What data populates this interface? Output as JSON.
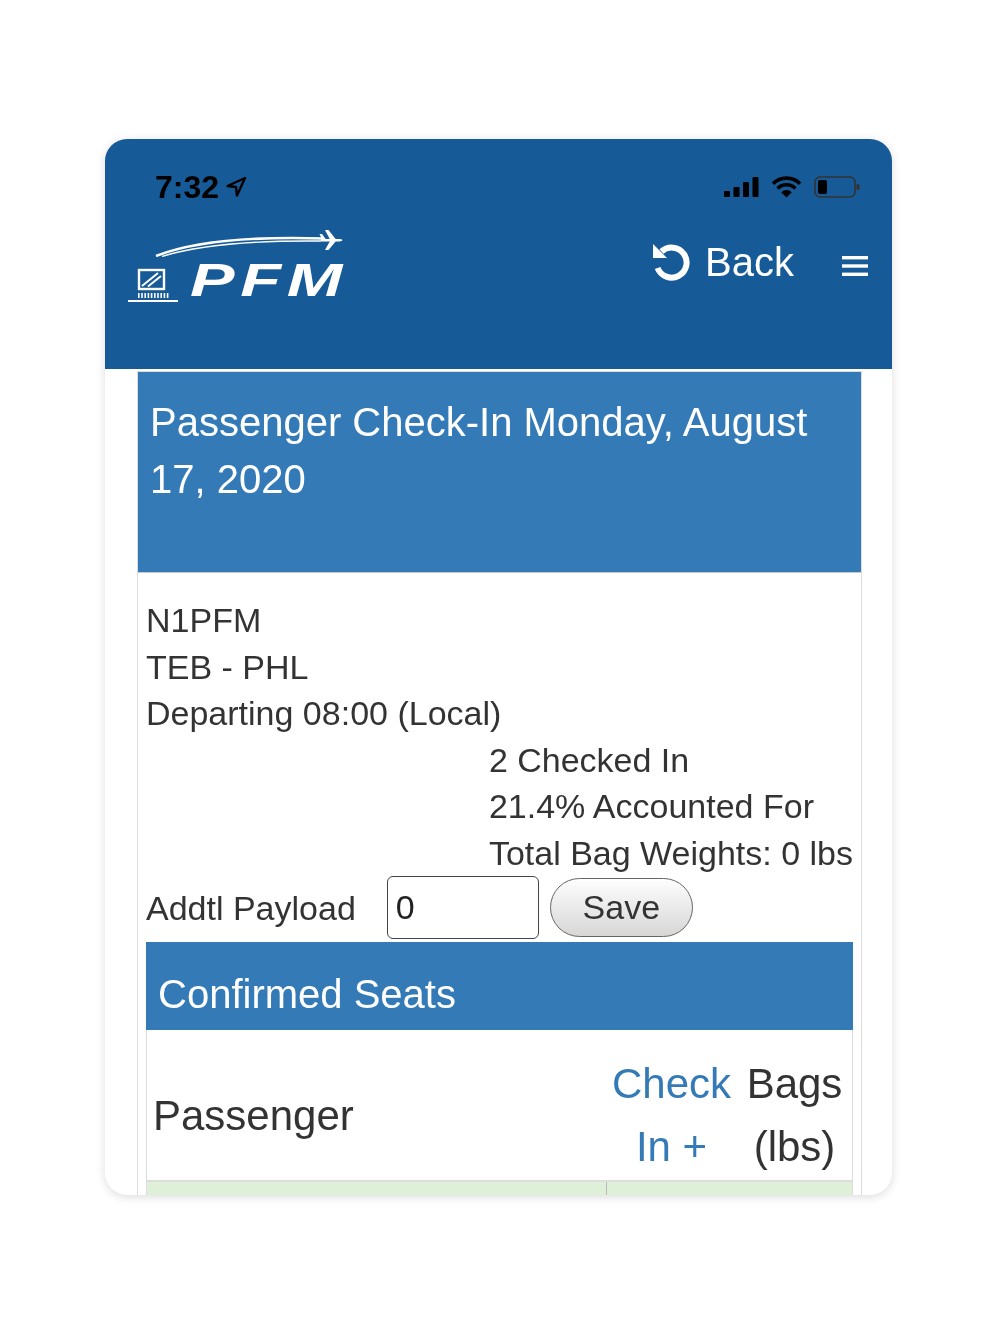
{
  "status_bar": {
    "time": "7:32"
  },
  "navbar": {
    "logo_text": "PFM",
    "back_label": "Back"
  },
  "page_title": "Passenger Check-In Monday, August 17, 2020",
  "flight": {
    "tail_number": "N1PFM",
    "route": "TEB - PHL",
    "departure": "Departing 08:00 (Local)"
  },
  "summary": [
    "2 Checked In",
    "21.4% Accounted For",
    "Total Bag Weights: 0 lbs"
  ],
  "payload": {
    "label": "Addtl Payload",
    "value": "0",
    "button": "Save"
  },
  "confirmed_seats": {
    "title": "Confirmed Seats",
    "columns": [
      {
        "label": "Passenger",
        "kind": "text"
      },
      {
        "label": "Check In +",
        "kind": "link"
      },
      {
        "label": "Bags (lbs)",
        "kind": "text"
      }
    ],
    "rows": [
      {
        "highlighted": true
      }
    ]
  }
}
